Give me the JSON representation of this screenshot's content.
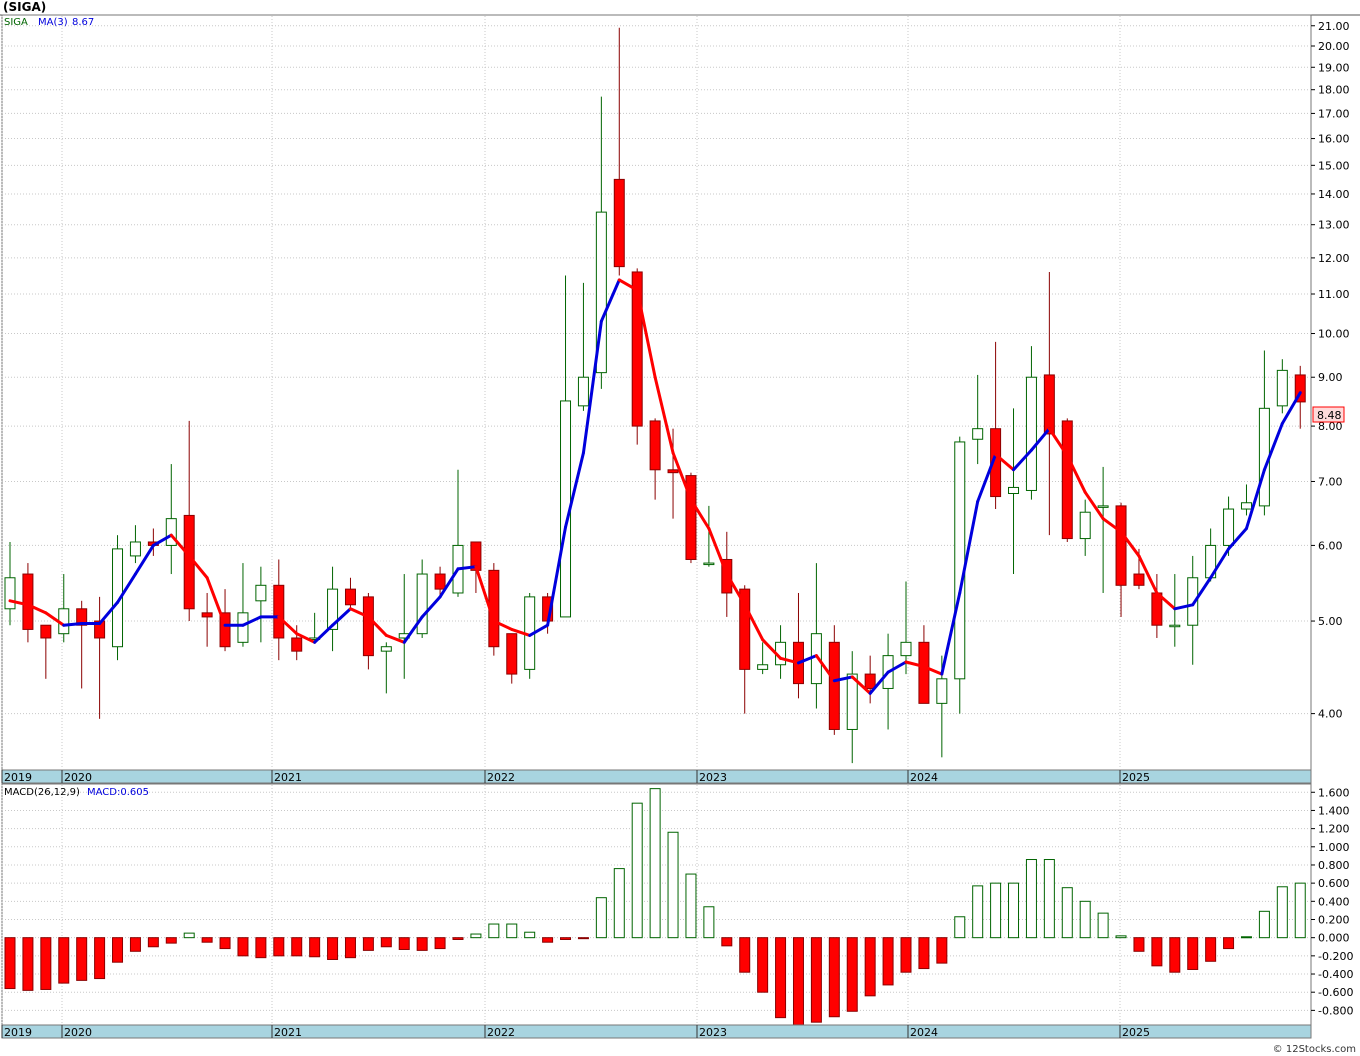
{
  "header": {
    "symbol": "(SIGA)"
  },
  "price_legend": {
    "symbol": "SIGA",
    "ma_label": "MA(3)",
    "ma_value": "8.67"
  },
  "macd_legend": {
    "label": "MACD(26,12,9)",
    "value_label": "MACD:0.605"
  },
  "last_price_label": "8.48",
  "watermark": "© 12Stocks.com",
  "colors": {
    "up": "#006400",
    "down": "#ff0000",
    "ma_up": "#0000dd",
    "ma_down": "#ff0000",
    "axis_band": "#a8d4e0"
  },
  "chart_data": [
    {
      "type": "candlestick",
      "scale": "log",
      "ylim": [
        3.5,
        21.5
      ],
      "y_ticks": [
        "4.00",
        "5.00",
        "6.00",
        "7.00",
        "8.00",
        "9.00",
        "10.00",
        "11.00",
        "12.00",
        "13.00",
        "14.00",
        "15.00",
        "16.00",
        "17.00",
        "18.00",
        "19.00",
        "20.00",
        "21.00"
      ],
      "x_labels": [
        "2019",
        "2020",
        "2021",
        "2022",
        "2023",
        "2024",
        "2025"
      ],
      "series_legend": [
        "SIGA",
        "MA(3)"
      ],
      "last_value": 8.48,
      "ma3_last": 8.67,
      "candles": [
        {
          "o": 5.15,
          "h": 6.05,
          "l": 4.95,
          "c": 5.55
        },
        {
          "o": 5.6,
          "h": 5.75,
          "l": 4.75,
          "c": 4.9
        },
        {
          "o": 4.95,
          "h": 4.95,
          "l": 4.35,
          "c": 4.8
        },
        {
          "o": 4.85,
          "h": 5.6,
          "l": 4.75,
          "c": 5.15
        },
        {
          "o": 5.15,
          "h": 5.25,
          "l": 4.25,
          "c": 4.95
        },
        {
          "o": 5.0,
          "h": 5.3,
          "l": 3.95,
          "c": 4.8
        },
        {
          "o": 4.7,
          "h": 6.15,
          "l": 4.55,
          "c": 5.95
        },
        {
          "o": 5.85,
          "h": 6.3,
          "l": 5.75,
          "c": 6.05
        },
        {
          "o": 6.05,
          "h": 6.25,
          "l": 5.85,
          "c": 6.0
        },
        {
          "o": 6.0,
          "h": 7.3,
          "l": 5.6,
          "c": 6.4
        },
        {
          "o": 6.45,
          "h": 8.1,
          "l": 5.0,
          "c": 5.15
        },
        {
          "o": 5.1,
          "h": 5.35,
          "l": 4.7,
          "c": 5.05
        },
        {
          "o": 5.1,
          "h": 5.4,
          "l": 4.65,
          "c": 4.7
        },
        {
          "o": 4.75,
          "h": 5.75,
          "l": 4.7,
          "c": 5.1
        },
        {
          "o": 5.25,
          "h": 5.7,
          "l": 4.75,
          "c": 5.45
        },
        {
          "o": 5.45,
          "h": 5.8,
          "l": 4.55,
          "c": 4.8
        },
        {
          "o": 4.8,
          "h": 4.95,
          "l": 4.55,
          "c": 4.65
        },
        {
          "o": 4.8,
          "h": 5.1,
          "l": 4.75,
          "c": 4.8
        },
        {
          "o": 4.9,
          "h": 5.7,
          "l": 4.65,
          "c": 5.4
        },
        {
          "o": 5.4,
          "h": 5.55,
          "l": 5.15,
          "c": 5.2
        },
        {
          "o": 5.3,
          "h": 5.35,
          "l": 4.45,
          "c": 4.6
        },
        {
          "o": 4.65,
          "h": 4.75,
          "l": 4.2,
          "c": 4.7
        },
        {
          "o": 4.8,
          "h": 5.6,
          "l": 4.35,
          "c": 4.85
        },
        {
          "o": 4.85,
          "h": 5.8,
          "l": 4.8,
          "c": 5.6
        },
        {
          "o": 5.6,
          "h": 5.7,
          "l": 5.3,
          "c": 5.4
        },
        {
          "o": 5.35,
          "h": 7.2,
          "l": 5.3,
          "c": 6.0
        },
        {
          "o": 6.05,
          "h": 6.05,
          "l": 5.35,
          "c": 5.65
        },
        {
          "o": 5.65,
          "h": 5.75,
          "l": 4.6,
          "c": 4.7
        },
        {
          "o": 4.85,
          "h": 4.85,
          "l": 4.3,
          "c": 4.4
        },
        {
          "o": 4.45,
          "h": 5.35,
          "l": 4.35,
          "c": 5.3
        },
        {
          "o": 5.3,
          "h": 5.35,
          "l": 4.85,
          "c": 5.0
        },
        {
          "o": 5.05,
          "h": 11.5,
          "l": 5.05,
          "c": 8.5
        },
        {
          "o": 8.4,
          "h": 11.3,
          "l": 8.3,
          "c": 9.0
        },
        {
          "o": 9.1,
          "h": 17.7,
          "l": 8.75,
          "c": 13.4
        },
        {
          "o": 14.5,
          "h": 20.9,
          "l": 11.5,
          "c": 11.75
        },
        {
          "o": 11.6,
          "h": 11.7,
          "l": 7.65,
          "c": 8.0
        },
        {
          "o": 8.1,
          "h": 8.15,
          "l": 6.7,
          "c": 7.2
        },
        {
          "o": 7.2,
          "h": 7.95,
          "l": 6.4,
          "c": 7.15
        },
        {
          "o": 7.1,
          "h": 7.15,
          "l": 5.75,
          "c": 5.8
        },
        {
          "o": 5.75,
          "h": 6.6,
          "l": 5.7,
          "c": 5.75
        },
        {
          "o": 5.8,
          "h": 6.2,
          "l": 5.05,
          "c": 5.35
        },
        {
          "o": 5.4,
          "h": 5.45,
          "l": 4.0,
          "c": 4.45
        },
        {
          "o": 4.45,
          "h": 4.75,
          "l": 4.4,
          "c": 4.5
        },
        {
          "o": 4.5,
          "h": 4.95,
          "l": 4.35,
          "c": 4.75
        },
        {
          "o": 4.75,
          "h": 5.35,
          "l": 4.15,
          "c": 4.3
        },
        {
          "o": 4.3,
          "h": 5.75,
          "l": 4.05,
          "c": 4.85
        },
        {
          "o": 4.75,
          "h": 4.95,
          "l": 3.8,
          "c": 3.85
        },
        {
          "o": 3.85,
          "h": 4.65,
          "l": 3.55,
          "c": 4.4
        },
        {
          "o": 4.4,
          "h": 4.6,
          "l": 4.1,
          "c": 4.25
        },
        {
          "o": 4.25,
          "h": 4.85,
          "l": 3.85,
          "c": 4.6
        },
        {
          "o": 4.6,
          "h": 5.5,
          "l": 4.4,
          "c": 4.75
        },
        {
          "o": 4.75,
          "h": 4.95,
          "l": 4.1,
          "c": 4.1
        },
        {
          "o": 4.1,
          "h": 4.6,
          "l": 3.6,
          "c": 4.35
        },
        {
          "o": 4.35,
          "h": 7.8,
          "l": 4.0,
          "c": 7.7
        },
        {
          "o": 7.75,
          "h": 9.05,
          "l": 7.3,
          "c": 7.95
        },
        {
          "o": 7.95,
          "h": 9.8,
          "l": 6.55,
          "c": 6.75
        },
        {
          "o": 6.8,
          "h": 8.35,
          "l": 5.6,
          "c": 6.9
        },
        {
          "o": 6.85,
          "h": 9.7,
          "l": 6.7,
          "c": 9.0
        },
        {
          "o": 9.05,
          "h": 11.6,
          "l": 6.15,
          "c": 7.85
        },
        {
          "o": 8.1,
          "h": 8.15,
          "l": 6.05,
          "c": 6.1
        },
        {
          "o": 6.1,
          "h": 6.7,
          "l": 5.85,
          "c": 6.5
        },
        {
          "o": 6.6,
          "h": 7.25,
          "l": 5.35,
          "c": 6.6
        },
        {
          "o": 6.6,
          "h": 6.65,
          "l": 5.05,
          "c": 5.45
        },
        {
          "o": 5.6,
          "h": 5.95,
          "l": 5.4,
          "c": 5.45
        },
        {
          "o": 5.35,
          "h": 5.6,
          "l": 4.8,
          "c": 4.95
        },
        {
          "o": 4.95,
          "h": 5.6,
          "l": 4.7,
          "c": 4.95
        },
        {
          "o": 4.95,
          "h": 5.85,
          "l": 4.5,
          "c": 5.55
        },
        {
          "o": 5.55,
          "h": 6.25,
          "l": 5.5,
          "c": 6.0
        },
        {
          "o": 6.0,
          "h": 6.75,
          "l": 5.85,
          "c": 6.55
        },
        {
          "o": 6.55,
          "h": 6.95,
          "l": 6.45,
          "c": 6.65
        },
        {
          "o": 6.6,
          "h": 9.6,
          "l": 6.45,
          "c": 8.35
        },
        {
          "o": 8.4,
          "h": 9.4,
          "l": 8.25,
          "c": 9.15
        },
        {
          "o": 9.05,
          "h": 9.25,
          "l": 7.95,
          "c": 8.48
        }
      ],
      "ma3": [
        5.25,
        5.2,
        5.1,
        4.95,
        4.97,
        4.97,
        5.23,
        5.6,
        6.0,
        6.15,
        5.85,
        5.55,
        4.95,
        4.95,
        5.05,
        5.05,
        4.85,
        4.75,
        4.95,
        5.15,
        5.05,
        4.83,
        4.75,
        5.05,
        5.3,
        5.67,
        5.7,
        5.0,
        4.9,
        4.83,
        4.95,
        6.27,
        7.5,
        10.3,
        11.38,
        11.1,
        9.0,
        7.5,
        6.7,
        6.25,
        5.6,
        5.2,
        4.78,
        4.57,
        4.52,
        4.6,
        4.33,
        4.37,
        4.2,
        4.42,
        4.53,
        4.48,
        4.4,
        5.35,
        6.67,
        7.47,
        7.2,
        7.55,
        7.95,
        7.45,
        6.82,
        6.4,
        6.2,
        5.85,
        5.35,
        5.15,
        5.2,
        5.55,
        5.95,
        6.25,
        7.2,
        8.05,
        8.67
      ]
    },
    {
      "type": "bar",
      "title": "MACD(26,12,9)",
      "ylim": [
        -0.95,
        1.68
      ],
      "y_ticks": [
        "-0.800",
        "-0.600",
        "-0.400",
        "-0.200",
        "0.000",
        "0.200",
        "0.400",
        "0.600",
        "0.800",
        "1.000",
        "1.200",
        "1.400",
        "1.600"
      ],
      "x_labels": [
        "2019",
        "2020",
        "2021",
        "2022",
        "2023",
        "2024",
        "2025"
      ],
      "last_value": 0.605,
      "values": [
        -0.56,
        -0.58,
        -0.57,
        -0.5,
        -0.47,
        -0.45,
        -0.27,
        -0.15,
        -0.1,
        -0.06,
        0.05,
        -0.05,
        -0.12,
        -0.2,
        -0.22,
        -0.2,
        -0.2,
        -0.21,
        -0.24,
        -0.22,
        -0.14,
        -0.1,
        -0.13,
        -0.14,
        -0.12,
        -0.02,
        0.04,
        0.15,
        0.15,
        0.06,
        -0.05,
        -0.02,
        -0.01,
        0.44,
        0.76,
        1.48,
        1.64,
        1.16,
        0.7,
        0.34,
        -0.09,
        -0.38,
        -0.6,
        -0.88,
        -0.96,
        -0.93,
        -0.87,
        -0.81,
        -0.64,
        -0.52,
        -0.38,
        -0.34,
        -0.28,
        0.23,
        0.57,
        0.6,
        0.6,
        0.86,
        0.86,
        0.55,
        0.4,
        0.27,
        0.02,
        -0.15,
        -0.31,
        -0.38,
        -0.35,
        -0.26,
        -0.12,
        0.01,
        0.29,
        0.56,
        0.6
      ]
    }
  ]
}
